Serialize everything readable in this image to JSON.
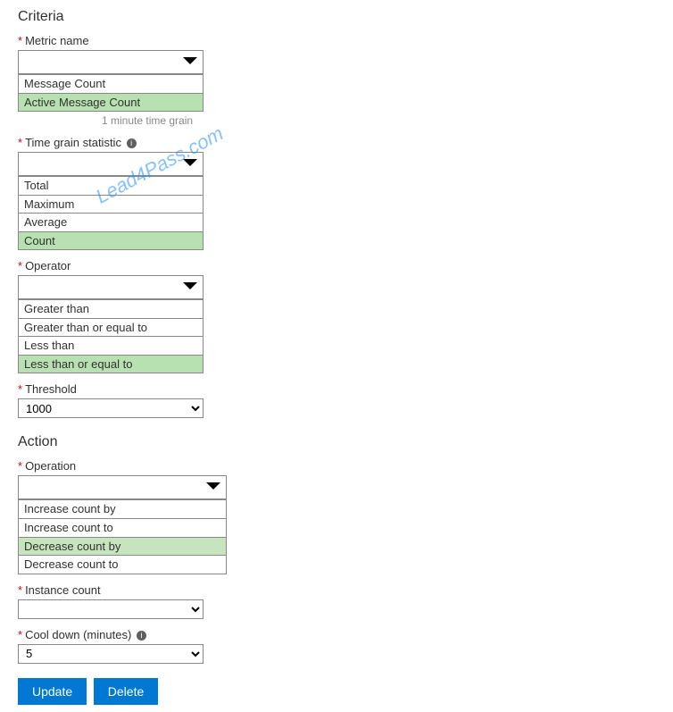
{
  "criteria": {
    "heading": "Criteria",
    "metric": {
      "label": "Metric name",
      "options": [
        "Message Count",
        "Active Message Count"
      ],
      "highlighted": "Active Message Count",
      "helper": "1 minute time grain"
    },
    "timegrain": {
      "label": "Time grain statistic",
      "options": [
        "Total",
        "Maximum",
        "Average",
        "Count"
      ],
      "highlighted": "Count"
    },
    "operator": {
      "label": "Operator",
      "options": [
        "Greater than",
        "Greater than or equal to",
        "Less than",
        "Less than or equal to"
      ],
      "highlighted": "Less than or equal to"
    },
    "threshold": {
      "label": "Threshold",
      "value": "1000"
    }
  },
  "action": {
    "heading": "Action",
    "operation": {
      "label": "Operation",
      "options": [
        "Increase count by",
        "Increase count to",
        "Decrease count by",
        "Decrease count to"
      ],
      "highlighted": "Decrease count by"
    },
    "instancecount": {
      "label": "Instance count",
      "value": ""
    },
    "cooldown": {
      "label": "Cool down (minutes)",
      "value": "5"
    }
  },
  "buttons": {
    "update": "Update",
    "delete": "Delete"
  },
  "watermark": "Lead4Pass.com",
  "asterisk": "*"
}
